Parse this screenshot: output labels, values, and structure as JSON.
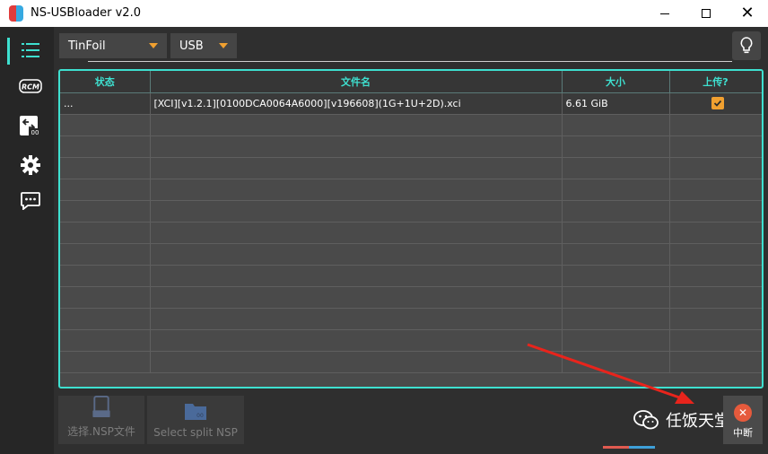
{
  "window": {
    "title": "NS-USBloader v2.0",
    "minimize": "—",
    "close": "✕"
  },
  "sidebar": {
    "items": [
      {
        "icon": "list-icon",
        "active": true
      },
      {
        "icon": "rcm-icon",
        "label": "RCM"
      },
      {
        "icon": "split-merge-icon",
        "label": "00"
      },
      {
        "icon": "gear-icon"
      },
      {
        "icon": "chat-icon"
      }
    ]
  },
  "toolbar": {
    "protocol": "TinFoil",
    "network": "USB"
  },
  "table": {
    "headers": [
      "状态",
      "文件名",
      "大小",
      "上传?"
    ],
    "rows": [
      {
        "status": "...",
        "filename": "[XCI][v1.2.1][0100DCA0064A6000][v196608](1G+1U+2D).xci",
        "size": "6.61 GiB",
        "upload": true
      }
    ],
    "empty_rows": 12
  },
  "buttons": {
    "select_nsp": "选择.NSP文件",
    "split_nsp": "Select split NSP",
    "stop": "中断"
  },
  "watermark": {
    "text": "任饭天堂"
  },
  "colors": {
    "accent": "#3ee0d0",
    "checkbox": "#f0a030",
    "stop": "#e65a3c"
  }
}
